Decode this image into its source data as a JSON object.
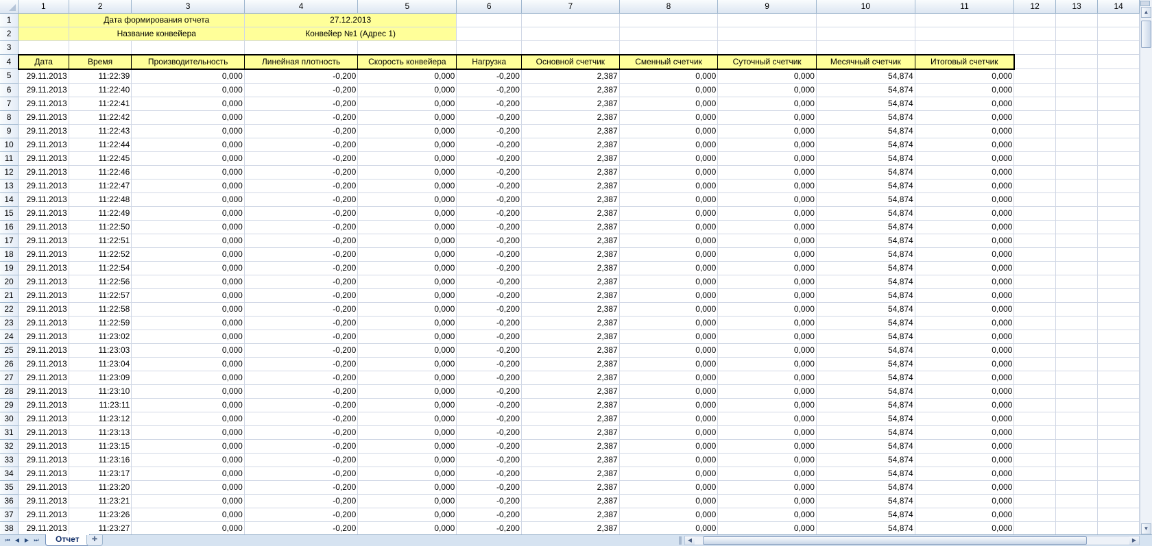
{
  "columns": [
    "1",
    "2",
    "3",
    "4",
    "5",
    "6",
    "7",
    "8",
    "9",
    "10",
    "11",
    "12",
    "13",
    "14"
  ],
  "info": [
    {
      "label": "Дата формирования отчета",
      "value": "27.12.2013"
    },
    {
      "label": "Название конвейера",
      "value": "Конвейер №1 (Адрес 1)"
    }
  ],
  "headers": [
    "Дата",
    "Время",
    "Производительность",
    "Линейная плотность",
    "Скорость конвейера",
    "Нагрузка",
    "Основной счетчик",
    "Сменный счетчик",
    "Суточный счетчик",
    "Месячный счетчик",
    "Итоговый счетчик"
  ],
  "rows": [
    [
      "29.11.2013",
      "11:22:39",
      "0,000",
      "-0,200",
      "0,000",
      "-0,200",
      "2,387",
      "0,000",
      "0,000",
      "54,874",
      "0,000"
    ],
    [
      "29.11.2013",
      "11:22:40",
      "0,000",
      "-0,200",
      "0,000",
      "-0,200",
      "2,387",
      "0,000",
      "0,000",
      "54,874",
      "0,000"
    ],
    [
      "29.11.2013",
      "11:22:41",
      "0,000",
      "-0,200",
      "0,000",
      "-0,200",
      "2,387",
      "0,000",
      "0,000",
      "54,874",
      "0,000"
    ],
    [
      "29.11.2013",
      "11:22:42",
      "0,000",
      "-0,200",
      "0,000",
      "-0,200",
      "2,387",
      "0,000",
      "0,000",
      "54,874",
      "0,000"
    ],
    [
      "29.11.2013",
      "11:22:43",
      "0,000",
      "-0,200",
      "0,000",
      "-0,200",
      "2,387",
      "0,000",
      "0,000",
      "54,874",
      "0,000"
    ],
    [
      "29.11.2013",
      "11:22:44",
      "0,000",
      "-0,200",
      "0,000",
      "-0,200",
      "2,387",
      "0,000",
      "0,000",
      "54,874",
      "0,000"
    ],
    [
      "29.11.2013",
      "11:22:45",
      "0,000",
      "-0,200",
      "0,000",
      "-0,200",
      "2,387",
      "0,000",
      "0,000",
      "54,874",
      "0,000"
    ],
    [
      "29.11.2013",
      "11:22:46",
      "0,000",
      "-0,200",
      "0,000",
      "-0,200",
      "2,387",
      "0,000",
      "0,000",
      "54,874",
      "0,000"
    ],
    [
      "29.11.2013",
      "11:22:47",
      "0,000",
      "-0,200",
      "0,000",
      "-0,200",
      "2,387",
      "0,000",
      "0,000",
      "54,874",
      "0,000"
    ],
    [
      "29.11.2013",
      "11:22:48",
      "0,000",
      "-0,200",
      "0,000",
      "-0,200",
      "2,387",
      "0,000",
      "0,000",
      "54,874",
      "0,000"
    ],
    [
      "29.11.2013",
      "11:22:49",
      "0,000",
      "-0,200",
      "0,000",
      "-0,200",
      "2,387",
      "0,000",
      "0,000",
      "54,874",
      "0,000"
    ],
    [
      "29.11.2013",
      "11:22:50",
      "0,000",
      "-0,200",
      "0,000",
      "-0,200",
      "2,387",
      "0,000",
      "0,000",
      "54,874",
      "0,000"
    ],
    [
      "29.11.2013",
      "11:22:51",
      "0,000",
      "-0,200",
      "0,000",
      "-0,200",
      "2,387",
      "0,000",
      "0,000",
      "54,874",
      "0,000"
    ],
    [
      "29.11.2013",
      "11:22:52",
      "0,000",
      "-0,200",
      "0,000",
      "-0,200",
      "2,387",
      "0,000",
      "0,000",
      "54,874",
      "0,000"
    ],
    [
      "29.11.2013",
      "11:22:54",
      "0,000",
      "-0,200",
      "0,000",
      "-0,200",
      "2,387",
      "0,000",
      "0,000",
      "54,874",
      "0,000"
    ],
    [
      "29.11.2013",
      "11:22:56",
      "0,000",
      "-0,200",
      "0,000",
      "-0,200",
      "2,387",
      "0,000",
      "0,000",
      "54,874",
      "0,000"
    ],
    [
      "29.11.2013",
      "11:22:57",
      "0,000",
      "-0,200",
      "0,000",
      "-0,200",
      "2,387",
      "0,000",
      "0,000",
      "54,874",
      "0,000"
    ],
    [
      "29.11.2013",
      "11:22:58",
      "0,000",
      "-0,200",
      "0,000",
      "-0,200",
      "2,387",
      "0,000",
      "0,000",
      "54,874",
      "0,000"
    ],
    [
      "29.11.2013",
      "11:22:59",
      "0,000",
      "-0,200",
      "0,000",
      "-0,200",
      "2,387",
      "0,000",
      "0,000",
      "54,874",
      "0,000"
    ],
    [
      "29.11.2013",
      "11:23:02",
      "0,000",
      "-0,200",
      "0,000",
      "-0,200",
      "2,387",
      "0,000",
      "0,000",
      "54,874",
      "0,000"
    ],
    [
      "29.11.2013",
      "11:23:03",
      "0,000",
      "-0,200",
      "0,000",
      "-0,200",
      "2,387",
      "0,000",
      "0,000",
      "54,874",
      "0,000"
    ],
    [
      "29.11.2013",
      "11:23:04",
      "0,000",
      "-0,200",
      "0,000",
      "-0,200",
      "2,387",
      "0,000",
      "0,000",
      "54,874",
      "0,000"
    ],
    [
      "29.11.2013",
      "11:23:09",
      "0,000",
      "-0,200",
      "0,000",
      "-0,200",
      "2,387",
      "0,000",
      "0,000",
      "54,874",
      "0,000"
    ],
    [
      "29.11.2013",
      "11:23:10",
      "0,000",
      "-0,200",
      "0,000",
      "-0,200",
      "2,387",
      "0,000",
      "0,000",
      "54,874",
      "0,000"
    ],
    [
      "29.11.2013",
      "11:23:11",
      "0,000",
      "-0,200",
      "0,000",
      "-0,200",
      "2,387",
      "0,000",
      "0,000",
      "54,874",
      "0,000"
    ],
    [
      "29.11.2013",
      "11:23:12",
      "0,000",
      "-0,200",
      "0,000",
      "-0,200",
      "2,387",
      "0,000",
      "0,000",
      "54,874",
      "0,000"
    ],
    [
      "29.11.2013",
      "11:23:13",
      "0,000",
      "-0,200",
      "0,000",
      "-0,200",
      "2,387",
      "0,000",
      "0,000",
      "54,874",
      "0,000"
    ],
    [
      "29.11.2013",
      "11:23:15",
      "0,000",
      "-0,200",
      "0,000",
      "-0,200",
      "2,387",
      "0,000",
      "0,000",
      "54,874",
      "0,000"
    ],
    [
      "29.11.2013",
      "11:23:16",
      "0,000",
      "-0,200",
      "0,000",
      "-0,200",
      "2,387",
      "0,000",
      "0,000",
      "54,874",
      "0,000"
    ],
    [
      "29.11.2013",
      "11:23:17",
      "0,000",
      "-0,200",
      "0,000",
      "-0,200",
      "2,387",
      "0,000",
      "0,000",
      "54,874",
      "0,000"
    ],
    [
      "29.11.2013",
      "11:23:20",
      "0,000",
      "-0,200",
      "0,000",
      "-0,200",
      "2,387",
      "0,000",
      "0,000",
      "54,874",
      "0,000"
    ],
    [
      "29.11.2013",
      "11:23:21",
      "0,000",
      "-0,200",
      "0,000",
      "-0,200",
      "2,387",
      "0,000",
      "0,000",
      "54,874",
      "0,000"
    ],
    [
      "29.11.2013",
      "11:23:26",
      "0,000",
      "-0,200",
      "0,000",
      "-0,200",
      "2,387",
      "0,000",
      "0,000",
      "54,874",
      "0,000"
    ],
    [
      "29.11.2013",
      "11:23:27",
      "0,000",
      "-0,200",
      "0,000",
      "-0,200",
      "2,387",
      "0,000",
      "0,000",
      "54,874",
      "0,000"
    ]
  ],
  "sheet_tab": "Отчет",
  "icons": {
    "nav_first": "first-sheet-icon",
    "nav_prev": "prev-sheet-icon",
    "nav_next": "next-sheet-icon",
    "nav_last": "last-sheet-icon",
    "new_sheet": "insert-sheet-icon"
  },
  "colors": {
    "header_fill": "#ffff99",
    "gridline": "#d0d7e5",
    "header_band": "#dde6f2"
  }
}
